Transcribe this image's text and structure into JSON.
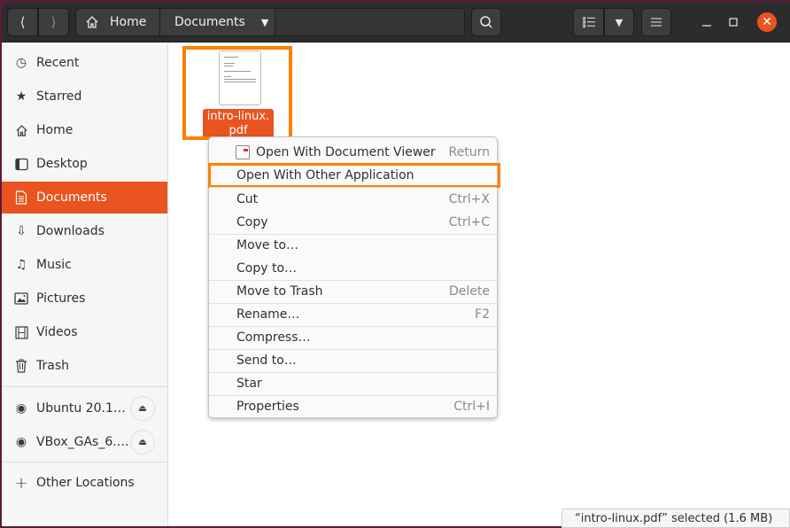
{
  "headerbar": {
    "back_icon": "chevron-left-icon",
    "forward_icon": "chevron-right-icon",
    "breadcrumbs": [
      {
        "label": "Home",
        "icon": "home-icon"
      },
      {
        "label": "Documents",
        "icon": "caret-down-icon"
      }
    ],
    "search_icon": "search-icon",
    "view_list_icon": "list-view-icon",
    "view_options_icon": "caret-down-icon",
    "menu_icon": "hamburger-menu-icon",
    "window_controls": {
      "minimize": "minimize-icon",
      "maximize": "maximize-icon",
      "close": "close-icon"
    }
  },
  "sidebar": {
    "items": [
      {
        "label": "Recent",
        "icon": "clock-icon",
        "active": false
      },
      {
        "label": "Starred",
        "icon": "star-icon",
        "active": false
      },
      {
        "label": "Home",
        "icon": "home-icon",
        "active": false
      },
      {
        "label": "Desktop",
        "icon": "desktop-icon",
        "active": false
      },
      {
        "label": "Documents",
        "icon": "document-icon",
        "active": true
      },
      {
        "label": "Downloads",
        "icon": "download-icon",
        "active": false
      },
      {
        "label": "Music",
        "icon": "music-icon",
        "active": false
      },
      {
        "label": "Pictures",
        "icon": "picture-icon",
        "active": false
      },
      {
        "label": "Videos",
        "icon": "film-icon",
        "active": false
      },
      {
        "label": "Trash",
        "icon": "trash-icon",
        "active": false
      }
    ],
    "devices": [
      {
        "label": "Ubuntu 20.1…",
        "icon": "disc-icon",
        "eject_icon": "eject-icon"
      },
      {
        "label": "VBox_GAs_6.…",
        "icon": "disc-icon",
        "eject_icon": "eject-icon"
      }
    ],
    "other_locations": {
      "label": "Other Locations",
      "icon": "plus-icon"
    }
  },
  "content": {
    "file": {
      "name_line1": "intro-linux.",
      "name_line2": "pdf",
      "selected": true
    }
  },
  "context_menu": {
    "items": [
      {
        "label": "Open With Document Viewer",
        "accel": "Return",
        "icon": "document-viewer-icon"
      },
      {
        "label": "Open With Other Application",
        "accel": "",
        "highlighted": true
      },
      {
        "label": "Cut",
        "accel": "Ctrl+X"
      },
      {
        "label": "Copy",
        "accel": "Ctrl+C"
      },
      {
        "label": "Move to…",
        "accel": ""
      },
      {
        "label": "Copy to…",
        "accel": ""
      },
      {
        "label": "Move to Trash",
        "accel": "Delete"
      },
      {
        "label": "Rename…",
        "accel": "F2"
      },
      {
        "label": "Compress…",
        "accel": ""
      },
      {
        "label": "Send to…",
        "accel": ""
      },
      {
        "label": "Star",
        "accel": ""
      },
      {
        "label": "Properties",
        "accel": "Ctrl+I"
      }
    ]
  },
  "statusbar": {
    "text": "“intro-linux.pdf” selected  (1.6 MB)"
  },
  "colors": {
    "accent": "#e95420",
    "annotation": "#ff7f00",
    "headerbar": "#2c2c2c"
  }
}
